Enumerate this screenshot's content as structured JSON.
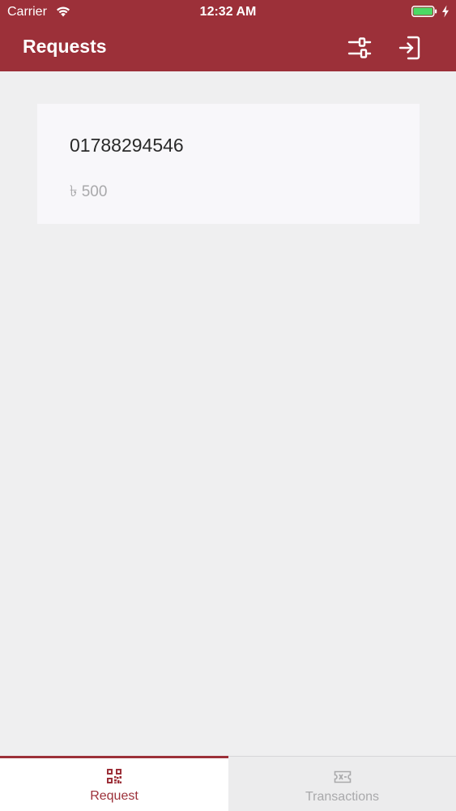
{
  "colors": {
    "brand": "#9c3039",
    "tab_inactive": "#a9a9ab"
  },
  "status_bar": {
    "carrier": "Carrier",
    "time": "12:32 AM",
    "icons": [
      "wifi-icon",
      "battery-icon",
      "charging-bolt-icon"
    ]
  },
  "nav": {
    "title": "Requests",
    "actions": [
      {
        "icon": "filter-sliders-icon"
      },
      {
        "icon": "logout-icon"
      }
    ]
  },
  "requests": [
    {
      "number": "01788294546",
      "amount": "৳ 500"
    }
  ],
  "tabs": [
    {
      "label": "Request",
      "icon": "qr-code-icon",
      "active": true
    },
    {
      "label": "Transactions",
      "icon": "ticket-icon",
      "active": false
    }
  ]
}
